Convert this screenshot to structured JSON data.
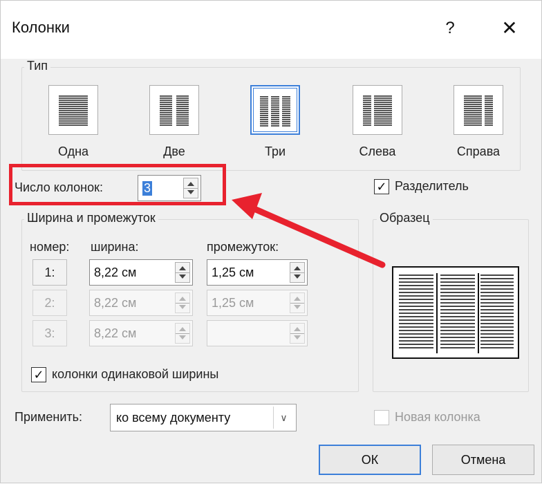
{
  "window": {
    "title": "Колонки",
    "help": "?",
    "close": "✕"
  },
  "type_group": {
    "label": "Тип",
    "options": [
      {
        "label": "Одна",
        "selected": false
      },
      {
        "label": "Две",
        "selected": false
      },
      {
        "label": "Три",
        "selected": true
      },
      {
        "label": "Слева",
        "selected": false
      },
      {
        "label": "Справа",
        "selected": false
      }
    ]
  },
  "num_columns": {
    "label": "Число колонок:",
    "value": "3"
  },
  "separator": {
    "label": "Разделитель",
    "checked": true,
    "check_glyph": "✓"
  },
  "width_spacing": {
    "label": "Ширина и промежуток",
    "col_number_header": "номер:",
    "col_width_header": "ширина:",
    "col_spacing_header": "промежуток:",
    "rows": [
      {
        "num": "1:",
        "width": "8,22 см",
        "spacing": "1,25 см",
        "enabled": true
      },
      {
        "num": "2:",
        "width": "8,22 см",
        "spacing": "1,25 см",
        "enabled": false
      },
      {
        "num": "3:",
        "width": "8,22 см",
        "spacing": "",
        "enabled": false
      }
    ],
    "equal_width": {
      "label": "колонки одинаковой ширины",
      "checked": true
    }
  },
  "preview": {
    "label": "Образец"
  },
  "apply": {
    "label": "Применить:",
    "value": "ко всему документу",
    "drop_glyph": "∨"
  },
  "new_column": {
    "label": "Новая колонка",
    "checked": false,
    "enabled": false
  },
  "buttons": {
    "ok": "ОК",
    "cancel": "Отмена"
  },
  "annotation": {
    "color": "#e8222e"
  },
  "colors": {
    "accent": "#3c7fd9",
    "dialog_bg": "#f0f0f0"
  }
}
